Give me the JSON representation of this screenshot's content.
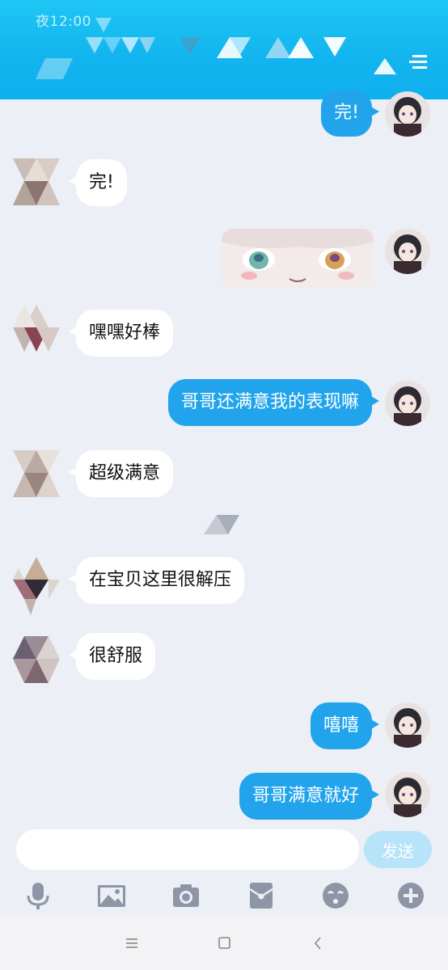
{
  "status_bar": {
    "time": "夜12:00"
  },
  "colors": {
    "header": "#12b4ef",
    "self_bubble": "#21a4ec",
    "other_bubble": "#ffffff",
    "background": "#eceff5",
    "send_button": "#b7e4f8",
    "toolbar_icon": "#8e96a6"
  },
  "messages": [
    {
      "side": "self",
      "type": "text",
      "text": "完!"
    },
    {
      "side": "other",
      "type": "text",
      "text": "完!"
    },
    {
      "side": "self",
      "type": "sticker",
      "icon": "anime-face-sticker"
    },
    {
      "side": "other",
      "type": "text",
      "text": "嘿嘿好棒"
    },
    {
      "side": "self",
      "type": "text",
      "text": "哥哥还满意我的表现嘛"
    },
    {
      "side": "other",
      "type": "text",
      "text": "超级满意"
    },
    {
      "side": "other",
      "type": "text",
      "text": "在宝贝这里很解压"
    },
    {
      "side": "other",
      "type": "text",
      "text": "很舒服"
    },
    {
      "side": "self",
      "type": "text",
      "text": "嘻嘻"
    },
    {
      "side": "self",
      "type": "text",
      "text": "哥哥满意就好"
    }
  ],
  "input": {
    "value": "",
    "placeholder": ""
  },
  "send_label": "发送",
  "toolbar": [
    "microphone-icon",
    "image-icon",
    "camera-icon",
    "red-packet-icon",
    "emoji-icon",
    "plus-icon"
  ],
  "nav": [
    "menu-icon",
    "home-icon",
    "back-icon"
  ]
}
